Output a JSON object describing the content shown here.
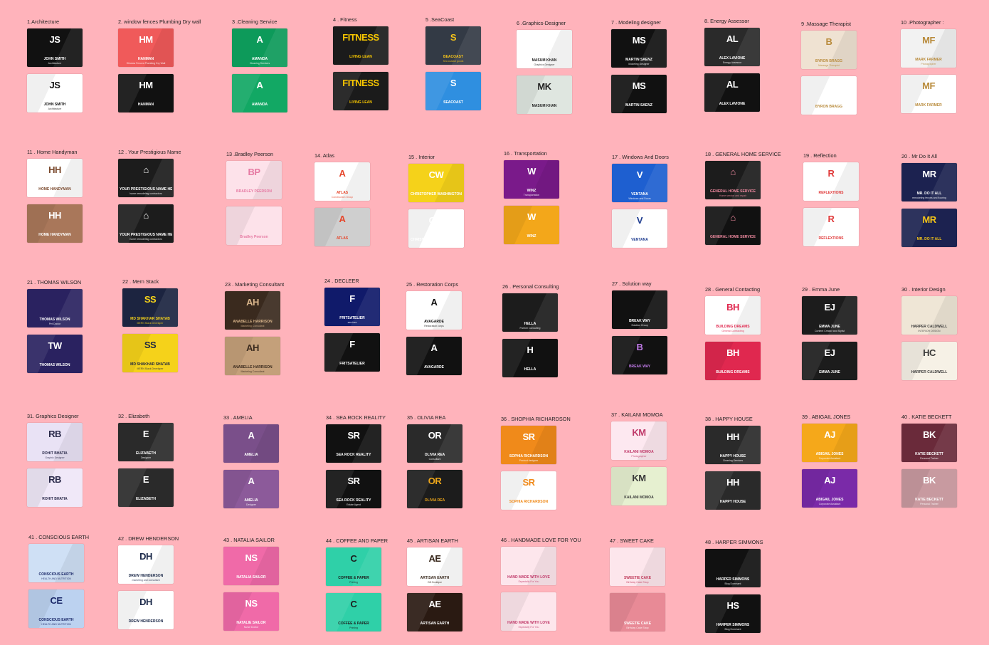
{
  "items": [
    {
      "label": "1.Architecture",
      "front": {
        "mono": "JS",
        "name": "JOHN SMITH",
        "sub": "Architecture"
      },
      "back": {
        "mono": "JS",
        "name": "JOHN SMITH",
        "sub": "Architecture"
      },
      "colors": [
        "#111111",
        "#ffffff"
      ],
      "ink": [
        "#ffffff",
        "#111111"
      ]
    },
    {
      "label": "2. window fences Plumbing Dry wall",
      "front": {
        "mono": "HM",
        "name": "HANMAN",
        "sub": "Window Fences Plumbing Dry Wall"
      },
      "back": {
        "mono": "HM",
        "name": "HANMAN",
        "sub": ""
      },
      "colors": [
        "#f05a5a",
        "#111111"
      ],
      "ink": [
        "#ffffff",
        "#ffffff"
      ]
    },
    {
      "label": "3 .Cleaning Service",
      "front": {
        "mono": "A",
        "name": "AMANDA",
        "sub": "Cleaning Services"
      },
      "back": {
        "mono": "A",
        "name": "AMANDA",
        "sub": ""
      },
      "colors": [
        "#0d9a5a",
        "#12a864"
      ],
      "ink": [
        "#ffffff",
        "#ffffff"
      ]
    },
    {
      "label": "4 . Fitness",
      "front": {
        "mono": "FITNESS",
        "name": "LIVING LEAN",
        "sub": ""
      },
      "back": {
        "mono": "FITNESS",
        "name": "LIVING LEAN",
        "sub": ""
      },
      "colors": [
        "#1b1b1b",
        "#1b1b1b"
      ],
      "ink": [
        "#f7c600",
        "#f7c600"
      ]
    },
    {
      "label": "5 .SeaCoast",
      "front": {
        "mono": "S",
        "name": "BEACOAST",
        "sub": "Sea coastal goods"
      },
      "back": {
        "mono": "S",
        "name": "SEACOAST",
        "sub": ""
      },
      "colors": [
        "#333a45",
        "#2f8fe0"
      ],
      "ink": [
        "#f3c21b",
        "#ffffff"
      ]
    },
    {
      "label": "6 .Graphics-Designer",
      "front": {
        "mono": "",
        "name": "MASUM KHAN",
        "sub": "Graphics Designer"
      },
      "back": {
        "mono": "MK",
        "name": "MASUM KHAN",
        "sub": ""
      },
      "colors": [
        "#ffffff",
        "#dfe6e0"
      ],
      "ink": [
        "#222222",
        "#222222"
      ]
    },
    {
      "label": "7 . Modeling designer",
      "front": {
        "mono": "MS",
        "name": "MARTIN SAENZ",
        "sub": "Modeling Designer"
      },
      "back": {
        "mono": "MS",
        "name": "MARTIN SAENZ",
        "sub": ""
      },
      "colors": [
        "#111111",
        "#111111"
      ],
      "ink": [
        "#ffffff",
        "#ffffff"
      ]
    },
    {
      "label": "8. Energy Assessor",
      "front": {
        "mono": "AL",
        "name": "ALEX LAVIONE",
        "sub": "Energy Assessor"
      },
      "back": {
        "mono": "AL",
        "name": "ALEX LAVIONE",
        "sub": ""
      },
      "colors": [
        "#2a2a2a",
        "#111111"
      ],
      "ink": [
        "#ffffff",
        "#ffffff"
      ]
    },
    {
      "label": "9 .Massage Therapist",
      "front": {
        "mono": "B",
        "name": "BYRON BRAGG",
        "sub": "Massage Therapist"
      },
      "back": {
        "mono": "",
        "name": "BYRON BRAGG",
        "sub": ""
      },
      "colors": [
        "#efe2d2",
        "#ffffff"
      ],
      "ink": [
        "#b88a3a",
        "#b88a3a"
      ]
    },
    {
      "label": "10 .Photographer :",
      "front": {
        "mono": "MF",
        "name": "MARK FARMER",
        "sub": "Photographer"
      },
      "back": {
        "mono": "MF",
        "name": "MARK FARMER",
        "sub": ""
      },
      "colors": [
        "#f2f2f2",
        "#ffffff"
      ],
      "ink": [
        "#b88a3a",
        "#b88a3a"
      ]
    },
    {
      "label": "11 . Home Handyman",
      "front": {
        "mono": "HH",
        "name": "HOME HANDYMAN",
        "sub": ""
      },
      "back": {
        "mono": "HH",
        "name": "HOME HANDYMAN",
        "sub": ""
      },
      "colors": [
        "#ffffff",
        "#a9775a"
      ],
      "ink": [
        "#7b4a2e",
        "#ffffff"
      ]
    },
    {
      "label": "12 . Your Prestigious Name",
      "front": {
        "mono": "⌂",
        "name": "YOUR PRESTIGIOUS NAME HERE",
        "sub": "home remodeling contractors"
      },
      "back": {
        "mono": "⌂",
        "name": "YOUR PRESTIGIOUS NAME HERE",
        "sub": "home remodeling contractors"
      },
      "colors": [
        "#1c1c1c",
        "#1c1c1c"
      ],
      "ink": [
        "#ffffff",
        "#ffffff"
      ]
    },
    {
      "label": "13 .Bradley Peerson",
      "front": {
        "mono": "BP",
        "name": "BRADLEY PEERSON",
        "sub": ""
      },
      "back": {
        "mono": "",
        "name": "Bradley Peerson",
        "sub": ""
      },
      "colors": [
        "#fde2ea",
        "#fde2ea"
      ],
      "ink": [
        "#e67aa3",
        "#e67aa3"
      ]
    },
    {
      "label": "14. Atlas",
      "front": {
        "mono": "A",
        "name": "ATLAS",
        "sub": "Construction Group"
      },
      "back": {
        "mono": "A",
        "name": "ATLAS",
        "sub": ""
      },
      "colors": [
        "#ffffff",
        "#cfcfcf"
      ],
      "ink": [
        "#e6452a",
        "#e6452a"
      ]
    },
    {
      "label": "15 . Interior",
      "front": {
        "mono": "CW",
        "name": "CHRISTOPHER WASHINGTON",
        "sub": ""
      },
      "back": {
        "mono": "CW",
        "name": "CHRISTOPHER WASHINGTON",
        "sub": ""
      },
      "colors": [
        "#f5d21a",
        "#ffffff"
      ],
      "ink": [
        "#ffffff",
        "#ffffff"
      ]
    },
    {
      "label": "16 . Transportation",
      "front": {
        "mono": "W",
        "name": "WINZ",
        "sub": "Transportation"
      },
      "back": {
        "mono": "W",
        "name": "WINZ",
        "sub": ""
      },
      "colors": [
        "#7a1a8a",
        "#f3a71a"
      ],
      "ink": [
        "#ffffff",
        "#ffffff"
      ]
    },
    {
      "label": "17 . Windows And Doors",
      "front": {
        "mono": "V",
        "name": "VENTANA",
        "sub": "Windows and Doors"
      },
      "back": {
        "mono": "V",
        "name": "VENTANA",
        "sub": ""
      },
      "colors": [
        "#1e5fd0",
        "#ffffff"
      ],
      "ink": [
        "#ffffff",
        "#1e3c8f"
      ]
    },
    {
      "label": "18 . GENERAL HOME SERVICE",
      "front": {
        "mono": "⌂",
        "name": "GENERAL HOME SERVICE",
        "sub": "Home service and repair"
      },
      "back": {
        "mono": "⌂",
        "name": "GENERAL HOME SERVICE",
        "sub": ""
      },
      "colors": [
        "#1c1c1c",
        "#111111"
      ],
      "ink": [
        "#f08aa0",
        "#f08aa0"
      ]
    },
    {
      "label": "19 . Reflection",
      "front": {
        "mono": "R",
        "name": "REFLEXTIONS",
        "sub": ""
      },
      "back": {
        "mono": "R",
        "name": "REFLEXTIONS",
        "sub": ""
      },
      "colors": [
        "#ffffff",
        "#ffffff"
      ],
      "ink": [
        "#e03a3a",
        "#e03a3a"
      ]
    },
    {
      "label": "20 . Mr Do It All",
      "front": {
        "mono": "MR",
        "name": "MR. DO IT ALL",
        "sub": "remodeling fences and flooring"
      },
      "back": {
        "mono": "MR",
        "name": "MR. DO IT ALL",
        "sub": ""
      },
      "colors": [
        "#1c2250",
        "#1c2250"
      ],
      "ink": [
        "#ffffff",
        "#f5c518"
      ]
    },
    {
      "label": "21 . THOMAS WILSON",
      "front": {
        "mono": "",
        "name": "THOMAS WILSON",
        "sub": "Pet Doctor"
      },
      "back": {
        "mono": "TW",
        "name": "THOMAS WILSON",
        "sub": ""
      },
      "colors": [
        "#2a2260",
        "#2a2260"
      ],
      "ink": [
        "#ffffff",
        "#ffffff"
      ]
    },
    {
      "label": "22 . Mern Stack",
      "front": {
        "mono": "SS",
        "name": "MD SHAKHAR SHATAB",
        "sub": "MERN Stack Developer"
      },
      "back": {
        "mono": "SS",
        "name": "MD SHAKHAR SHATAB",
        "sub": "MERN Stack Developer"
      },
      "colors": [
        "#1c2440",
        "#f5d21a"
      ],
      "ink": [
        "#f5d21a",
        "#1c2440"
      ]
    },
    {
      "label": "23 . Marketing Consultant",
      "front": {
        "mono": "AH",
        "name": "ANABELLE HARRISON",
        "sub": "Marketing Consultant"
      },
      "back": {
        "mono": "AH",
        "name": "ANABELLE HARRISON",
        "sub": "Marketing Consultant"
      },
      "colors": [
        "#3a2a1e",
        "#c4a07a"
      ],
      "ink": [
        "#d8b48a",
        "#3a2a1e"
      ]
    },
    {
      "label": "24 . DECLEER",
      "front": {
        "mono": "F",
        "name": "FRITSATELIER",
        "sub": "services"
      },
      "back": {
        "mono": "F",
        "name": "FRITSATELIER",
        "sub": ""
      },
      "colors": [
        "#101a6a",
        "#111111"
      ],
      "ink": [
        "#ffffff",
        "#ffffff"
      ]
    },
    {
      "label": "25 . Restoration Corps",
      "front": {
        "mono": "A",
        "name": "AVAGARDE",
        "sub": "Restoration corps"
      },
      "back": {
        "mono": "A",
        "name": "AVAGARDE",
        "sub": ""
      },
      "colors": [
        "#ffffff",
        "#111111"
      ],
      "ink": [
        "#111111",
        "#ffffff"
      ]
    },
    {
      "label": "26 . Personal Consulting",
      "front": {
        "mono": "",
        "name": "HELLA",
        "sub": "Partner Consulting"
      },
      "back": {
        "mono": "H",
        "name": "HELLA",
        "sub": ""
      },
      "colors": [
        "#1c1c1c",
        "#111111"
      ],
      "ink": [
        "#ffffff",
        "#ffffff"
      ]
    },
    {
      "label": "27 . Solution way",
      "front": {
        "mono": "",
        "name": "BREAK WAY",
        "sub": "Solution Group"
      },
      "back": {
        "mono": "B",
        "name": "BREAK WAY",
        "sub": ""
      },
      "colors": [
        "#111111",
        "#111111"
      ],
      "ink": [
        "#ffffff",
        "#c07ae8"
      ]
    },
    {
      "label": "28 . General Contacting",
      "front": {
        "mono": "BH",
        "name": "BUILDING DREAMS",
        "sub": "General Contracting"
      },
      "back": {
        "mono": "BH",
        "name": "BUILDING DREAMS",
        "sub": ""
      },
      "colors": [
        "#ffffff",
        "#e0284f"
      ],
      "ink": [
        "#e0284f",
        "#ffffff"
      ]
    },
    {
      "label": "29 . Emma June",
      "front": {
        "mono": "EJ",
        "name": "EMMA JUNE",
        "sub": "Content Creator and Stylist"
      },
      "back": {
        "mono": "EJ",
        "name": "EMMA JUNE",
        "sub": ""
      },
      "colors": [
        "#1c1c1c",
        "#1c1c1c"
      ],
      "ink": [
        "#ffffff",
        "#ffffff"
      ]
    },
    {
      "label": "30 . Interior Design",
      "front": {
        "mono": "",
        "name": "HARPER CALDWELL",
        "sub": "INTERIOR DESIGN"
      },
      "back": {
        "mono": "HC",
        "name": "HARPER CALDWELL",
        "sub": ""
      },
      "colors": [
        "#efe6d6",
        "#f6f1e6"
      ],
      "ink": [
        "#3a3a3a",
        "#3a3a3a"
      ]
    },
    {
      "label": "31. Graphics Designer",
      "front": {
        "mono": "RB",
        "name": "ROHIT BHATIA",
        "sub": "Graphic Designer"
      },
      "back": {
        "mono": "RB",
        "name": "ROHIT BHATIA",
        "sub": ""
      },
      "colors": [
        "#e9e2f5",
        "#f0e8f8"
      ],
      "ink": [
        "#2a2a4a",
        "#2a2a4a"
      ]
    },
    {
      "label": "32 . Elizabeth",
      "front": {
        "mono": "E",
        "name": "ELIZABETH",
        "sub": "Designer"
      },
      "back": {
        "mono": "E",
        "name": "ELIZABETH",
        "sub": ""
      },
      "colors": [
        "#2a2a2a",
        "#2a2a2a"
      ],
      "ink": [
        "#ffffff",
        "#ffffff"
      ]
    },
    {
      "label": "33 . AMELIA",
      "front": {
        "mono": "A",
        "name": "AMELIA",
        "sub": ""
      },
      "back": {
        "mono": "A",
        "name": "AMELIA",
        "sub": "Designer"
      },
      "colors": [
        "#7a4f8a",
        "#8c5a9a"
      ],
      "ink": [
        "#ffffff",
        "#ffffff"
      ]
    },
    {
      "label": "34 . SEA ROCK REALITY",
      "front": {
        "mono": "SR",
        "name": "SEA ROCK REALITY",
        "sub": ""
      },
      "back": {
        "mono": "SR",
        "name": "SEA ROCK REALITY",
        "sub": "Estate Agent"
      },
      "colors": [
        "#111111",
        "#111111"
      ],
      "ink": [
        "#ffffff",
        "#ffffff"
      ]
    },
    {
      "label": "35 . OLIVIA REA",
      "front": {
        "mono": "OR",
        "name": "OLIVIA REA",
        "sub": "Consultant"
      },
      "back": {
        "mono": "OR",
        "name": "OLIVIA REA",
        "sub": ""
      },
      "colors": [
        "#2a2a2a",
        "#1c1c1c"
      ],
      "ink": [
        "#ffffff",
        "#f0a81a"
      ]
    },
    {
      "label": "36 . SHOPHIA RICHARDSON",
      "front": {
        "mono": "SR",
        "name": "SOPHIA RICHARDSON",
        "sub": "Product designer"
      },
      "back": {
        "mono": "SR",
        "name": "SOPHIA RICHARDSON",
        "sub": ""
      },
      "colors": [
        "#f08a1a",
        "#ffffff"
      ],
      "ink": [
        "#ffffff",
        "#f08a1a"
      ]
    },
    {
      "label": "37 . KAILANI MOMOA",
      "front": {
        "mono": "KM",
        "name": "KAILANI MOMOA",
        "sub": "Photographer"
      },
      "back": {
        "mono": "KM",
        "name": "KAILANI MOMOA",
        "sub": ""
      },
      "colors": [
        "#fde8f0",
        "#e6f0d0"
      ],
      "ink": [
        "#c03a6a",
        "#3a3a3a"
      ]
    },
    {
      "label": "38 . HAPPY HOUSE",
      "front": {
        "mono": "HH",
        "name": "HAPPY HOUSE",
        "sub": "Cleaning Services"
      },
      "back": {
        "mono": "HH",
        "name": "HAPPY HOUSE",
        "sub": ""
      },
      "colors": [
        "#2a2a2a",
        "#2a2a2a"
      ],
      "ink": [
        "#ffffff",
        "#ffffff"
      ]
    },
    {
      "label": "39 . ABIGAIL JONES",
      "front": {
        "mono": "AJ",
        "name": "ABIGAIL JONES",
        "sub": "Corporate Assistant"
      },
      "back": {
        "mono": "AJ",
        "name": "ABIGAIL JONES",
        "sub": "Corporate Assistant"
      },
      "colors": [
        "#f5a81a",
        "#7a2aa8"
      ],
      "ink": [
        "#ffffff",
        "#ffffff"
      ]
    },
    {
      "label": "40 . KATIE BECKETT",
      "front": {
        "mono": "BK",
        "name": "KATIE BECKETT",
        "sub": "Personal Trainer"
      },
      "back": {
        "mono": "BK",
        "name": "KATIE BECKETT",
        "sub": "Personal Trainer"
      },
      "colors": [
        "#6a2a3a",
        "#c89aa0"
      ],
      "ink": [
        "#ffffff",
        "#ffffff"
      ]
    },
    {
      "label": "41 . CONSCIOUS EARTH",
      "front": {
        "mono": "",
        "name": "CONSCIOUS EARTH",
        "sub": "HEALTH AND NUTRITION"
      },
      "back": {
        "mono": "CE",
        "name": "CONSCIOUS EARTH",
        "sub": "HEALTH AND NUTRITION"
      },
      "colors": [
        "#cfe0f5",
        "#bcd2f0"
      ],
      "ink": [
        "#1c2a6a",
        "#1c2a6a"
      ]
    },
    {
      "label": "42 . DREW HENDERSON",
      "front": {
        "mono": "DH",
        "name": "DREW HENDERSON",
        "sub": "marketing and consultant"
      },
      "back": {
        "mono": "DH",
        "name": "DREW HENDERSON",
        "sub": ""
      },
      "colors": [
        "#ffffff",
        "#ffffff"
      ],
      "ink": [
        "#1c2a4a",
        "#1c2a4a"
      ]
    },
    {
      "label": "43 . NATALIA SAILOR",
      "front": {
        "mono": "NS",
        "name": "NATALIA SAILOR",
        "sub": ""
      },
      "back": {
        "mono": "NS",
        "name": "NATALIE SAILOR",
        "sub": "Nurse Doctor"
      },
      "colors": [
        "#f06aa8",
        "#f06aa8"
      ],
      "ink": [
        "#ffffff",
        "#ffffff"
      ]
    },
    {
      "label": "44 . COFFEE AND PAPER",
      "front": {
        "mono": "C",
        "name": "COFFEE & PAPER",
        "sub": "Printing"
      },
      "back": {
        "mono": "C",
        "name": "COFFEE & PAPER",
        "sub": "Printing"
      },
      "colors": [
        "#2fd0a8",
        "#2fd0a8"
      ],
      "ink": [
        "#1c1c1c",
        "#1c1c1c"
      ]
    },
    {
      "label": "45 . ARTISAN EARTH",
      "front": {
        "mono": "AE",
        "name": "ARTISAN EARTH",
        "sub": "Gift Boutique"
      },
      "back": {
        "mono": "AE",
        "name": "ARTISAN EARTH",
        "sub": ""
      },
      "colors": [
        "#ffffff",
        "#2a1a12"
      ],
      "ink": [
        "#3a2a1e",
        "#ffffff"
      ]
    },
    {
      "label": "46 . HANDMADE LOVE FOR YOU",
      "front": {
        "mono": "",
        "name": "HAND MADE WITH LOVE",
        "sub": "Especially For You"
      },
      "back": {
        "mono": "",
        "name": "HAND MADE WITH LOVE",
        "sub": "Especially For You"
      },
      "colors": [
        "#fde6ec",
        "#fde6ec"
      ],
      "ink": [
        "#c03a6a",
        "#c03a6a"
      ]
    },
    {
      "label": "47 . SWEET CAKE",
      "front": {
        "mono": "",
        "name": "SWEETIE CAKE",
        "sub": "Birthday Cake Shop"
      },
      "back": {
        "mono": "",
        "name": "SWEETIE CAKE",
        "sub": "Birthday Cake Shop"
      },
      "colors": [
        "#fde6ec",
        "#e88a96"
      ],
      "ink": [
        "#c03a5a",
        "#ffffff"
      ]
    },
    {
      "label": "48 . HARPER SIMMONS",
      "front": {
        "mono": "",
        "name": "HARPER SIMMONS",
        "sub": "Blog Dominant"
      },
      "back": {
        "mono": "HS",
        "name": "HARPER SIMMONS",
        "sub": "Blog Dominant"
      },
      "colors": [
        "#111111",
        "#111111"
      ],
      "ink": [
        "#ffffff",
        "#ffffff"
      ]
    }
  ]
}
